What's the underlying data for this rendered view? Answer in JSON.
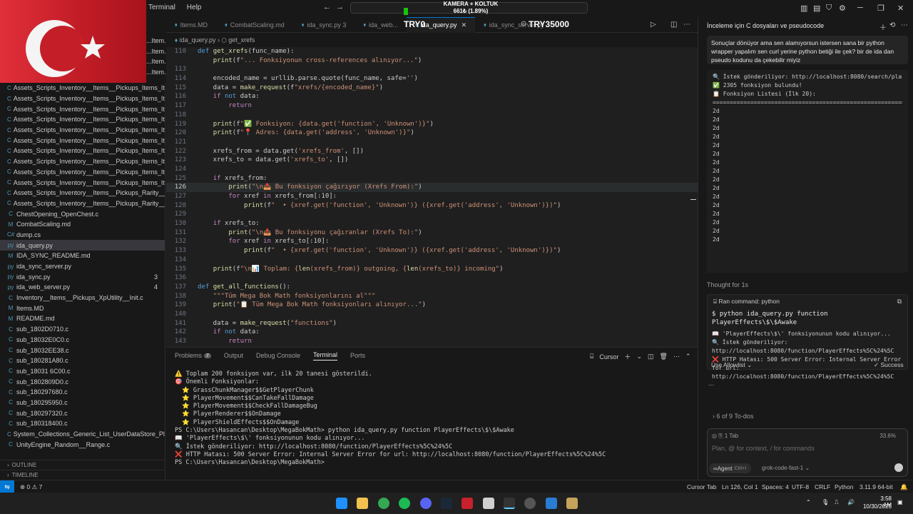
{
  "titlebar": {
    "menu": [
      "Terminal",
      "Help"
    ],
    "overlay_line1": "KAMERA + KOLTUK",
    "overlay_line2": "661₺ (1.89%)"
  },
  "tabs": [
    {
      "label": "Items.MD"
    },
    {
      "label": "CombatScaling.md"
    },
    {
      "label": "ida_sync.py 3"
    },
    {
      "label": "ida_web..."
    },
    {
      "label": "ida_query.py",
      "active": true
    },
    {
      "label": "ida_sync_server.py"
    }
  ],
  "tab_overlays": [
    "TRY0",
    "TRY35000"
  ],
  "breadcrumb": {
    "file": "ida_query.py",
    "symbol": "get_xrefs"
  },
  "explorer": {
    "top_strip": [
      "...Item...",
      "...Item...",
      "...Item...",
      "...Item..."
    ],
    "items": [
      {
        "label": "Assets_Scripts_Inventory__Items__Pickups_Items_Item...",
        "icon": "C"
      },
      {
        "label": "Assets_Scripts_Inventory__Items__Pickups_Items_Item...",
        "icon": "C"
      },
      {
        "label": "Assets_Scripts_Inventory__Items__Pickups_Items_Item...",
        "icon": "C"
      },
      {
        "label": "Assets_Scripts_Inventory__Items__Pickups_Items_Item...",
        "icon": "C"
      },
      {
        "label": "Assets_Scripts_Inventory__Items__Pickups_Items_Item...",
        "icon": "C"
      },
      {
        "label": "Assets_Scripts_Inventory__Items__Pickups_Items_Item...",
        "icon": "C"
      },
      {
        "label": "Assets_Scripts_Inventory__Items__Pickups_Items_Item...",
        "icon": "C"
      },
      {
        "label": "Assets_Scripts_Inventory__Items__Pickups_Items_Item...",
        "icon": "C"
      },
      {
        "label": "Assets_Scripts_Inventory__Items__Pickups_Items_Item...",
        "icon": "C"
      },
      {
        "label": "Assets_Scripts_Inventory__Items__Pickups_Items_Item...",
        "icon": "C"
      },
      {
        "label": "Assets_Scripts_Inventory__Items__Pickups_Rarity__Cal...",
        "icon": "C"
      },
      {
        "label": "Assets_Scripts_Inventory__Items__Pickups_Rarity__Ge...",
        "icon": "C"
      },
      {
        "label": "ChestOpening_OpenChest.c",
        "icon": "C"
      },
      {
        "label": "CombatScaling.md",
        "icon": "M"
      },
      {
        "label": "dump.cs",
        "icon": "C#"
      },
      {
        "label": "ida_query.py",
        "icon": "py",
        "active": true
      },
      {
        "label": "IDA_SYNC_README.md",
        "icon": "M"
      },
      {
        "label": "ida_sync_server.py",
        "icon": "py"
      },
      {
        "label": "ida_sync.py",
        "icon": "py",
        "badge": "3"
      },
      {
        "label": "ida_web_server.py",
        "icon": "py",
        "badge": "4"
      },
      {
        "label": "Inventory__Items__Pickups_XpUtility__Init.c",
        "icon": "C"
      },
      {
        "label": "Items.MD",
        "icon": "M"
      },
      {
        "label": "README.md",
        "icon": "M"
      },
      {
        "label": "sub_1802D0710.c",
        "icon": "C"
      },
      {
        "label": "sub_18032E0C0.c",
        "icon": "C"
      },
      {
        "label": "sub_18032EE38.c",
        "icon": "C"
      },
      {
        "label": "sub_180281A80.c",
        "icon": "C"
      },
      {
        "label": "sub_18031 6C00.c",
        "icon": "C"
      },
      {
        "label": "sub_1802809D0.c",
        "icon": "C"
      },
      {
        "label": "sub_180297680.c",
        "icon": "C"
      },
      {
        "label": "sub_180295950.c",
        "icon": "C"
      },
      {
        "label": "sub_180297320.c",
        "icon": "C"
      },
      {
        "label": "sub_180318400.c",
        "icon": "C"
      },
      {
        "label": "System_Collections_Generic_List_UserDataStore_Play...",
        "icon": "C"
      },
      {
        "label": "UnityEngine_Random__Range.c",
        "icon": "C"
      }
    ],
    "outline": "OUTLINE",
    "timeline": "TIMELINE"
  },
  "code": {
    "lines": [
      {
        "n": "110",
        "t": "def get_xrefs(func_name):"
      },
      {
        "n": "",
        "t": "    print(f\"... Fonksiyonun cross-references alınıyor...\")"
      },
      {
        "n": "113",
        "t": ""
      },
      {
        "n": "114",
        "t": "    encoded_name = urllib.parse.quote(func_name, safe='')"
      },
      {
        "n": "115",
        "t": "    data = make_request(f\"xrefs/{encoded_name}\")"
      },
      {
        "n": "116",
        "t": "    if not data:"
      },
      {
        "n": "117",
        "t": "        return"
      },
      {
        "n": "118",
        "t": ""
      },
      {
        "n": "119",
        "t": "    print(f\"✅ Fonksiyon: {data.get('function', 'Unknown')}\")"
      },
      {
        "n": "120",
        "t": "    print(f\"📍 Adres: {data.get('address', 'Unknown')}\")"
      },
      {
        "n": "121",
        "t": ""
      },
      {
        "n": "122",
        "t": "    xrefs_from = data.get('xrefs_from', [])"
      },
      {
        "n": "123",
        "t": "    xrefs_to = data.get('xrefs_to', [])"
      },
      {
        "n": "124",
        "t": ""
      },
      {
        "n": "125",
        "t": "    if xrefs_from:"
      },
      {
        "n": "126",
        "t": "        print(\"\\n📤 Bu fonksiyon çağırıyor (Xrefs From):\")",
        "current": true
      },
      {
        "n": "127",
        "t": "        for xref in xrefs_from[:10]:"
      },
      {
        "n": "128",
        "t": "            print(f\"  • {xref.get('function', 'Unknown')} ({xref.get('address', 'Unknown')})\")"
      },
      {
        "n": "129",
        "t": ""
      },
      {
        "n": "130",
        "t": "    if xrefs_to:"
      },
      {
        "n": "131",
        "t": "        print(\"\\n📥 Bu fonksiyonu çağıranlar (Xrefs To):\")"
      },
      {
        "n": "132",
        "t": "        for xref in xrefs_to[:10]:"
      },
      {
        "n": "133",
        "t": "            print(f\"  • {xref.get('function', 'Unknown')} ({xref.get('address', 'Unknown')})\")"
      },
      {
        "n": "134",
        "t": ""
      },
      {
        "n": "135",
        "t": "    print(f\"\\n📊 Toplam: {len(xrefs_from)} outgoing, {len(xrefs_to)} incoming\")"
      },
      {
        "n": "136",
        "t": ""
      },
      {
        "n": "137",
        "t": "def get_all_functions():"
      },
      {
        "n": "138",
        "t": "    \"\"\"Tüm Mega Bok Math fonksiyonlarını al\"\"\""
      },
      {
        "n": "139",
        "t": "    print(\"📋 Tüm Mega Bok Math fonksiyonları alınıyor...\")"
      },
      {
        "n": "140",
        "t": ""
      },
      {
        "n": "141",
        "t": "    data = make_request(\"functions\")"
      },
      {
        "n": "142",
        "t": "    if not data:"
      },
      {
        "n": "143",
        "t": "        return"
      }
    ]
  },
  "panel": {
    "tabs": [
      "Problems",
      "Output",
      "Debug Console",
      "Terminal",
      "Ports"
    ],
    "problems_count": "7",
    "shell_label": "Cursor",
    "terminal_lines": [
      "⚠️ Toplam 200 fonksiyon var, ilk 20 tanesi gösterildi.",
      "",
      "🎯 Önemli Fonksiyonlar:",
      "  ⭐ GrassChunkManager$$GetPlayerChunk",
      "  ⭐ PlayerMovement$$CanTakeFallDamage",
      "  ⭐ PlayerMovement$$CheckFallDamageBug",
      "  ⭐ PlayerRenderer$$OnDamage",
      "  ⭐ PlayerShieldEffects$$OnDamage",
      "PS C:\\Users\\Hasancan\\Desktop\\MegaBokMath> python ida_query.py function PlayerEffects\\$\\$Awake",
      "📖 'PlayerEffects\\$\\' fonksiyonunun kodu alınıyor...",
      "🔍 İstek gönderiliyor: http://localhost:8080/function/PlayerEffects%5C%24%5C",
      "❌ HTTP Hatası: 500 Server Error: Internal Server Error for url: http://localhost:8080/function/PlayerEffects%5C%24%5C",
      "PS C:\\Users\\Hasancan\\Desktop\\MegaBokMath> "
    ]
  },
  "agent": {
    "title": "İnceleme için C dosyaları ve pseudocode",
    "user_message": "Sonuçlar dönüyor ama sen alamıyorsun istersen sana bir python wrapper yapalım sen curl yerine python betiği ile çek? bir de ida dan pseudo kodunu da çekebilir miyiz",
    "output1": [
      "🔍 İstek gönderiliyor: http://localhost:8080/search/player",
      "✅ 2305 fonksiyon bulundu!",
      "",
      "📋 Fonksiyon Listesi (İlk 20):",
      "==============================================================",
      "2d",
      "2d",
      "2d",
      "2d",
      "2d",
      "2d",
      "2d",
      "2d",
      "2d",
      "2d",
      "2d",
      "2d",
      "2d",
      "2d",
      "2d",
      "2d"
    ],
    "thought": "Thought for 1s",
    "run_label": "Ran command: python",
    "run_cmd": "$ python ida_query.py function PlayerEffects\\$\\$Awake",
    "run_output": [
      "📖 'PlayerEffects\\$\\' fonksiyonunun kodu alınıyor...",
      "🔍 İstek gönderiliyor: http://localhost:8080/function/PlayerEffects%5C%24%5C",
      "❌ HTTP Hatası: 500 Server Error: Internal Server Error for url: http://localhost:8080/function/PlayerEffects%5C%24%5C"
    ],
    "allowlist": "Use Allowlist",
    "success": "Success",
    "dots": "...",
    "todos": "6 of 9 To-dos",
    "tab_count": "1 Tab",
    "context_pct": "33.6%",
    "input_placeholder": "Plan, @ for context, / for commands",
    "mode": "Agent",
    "mode_shortcut": "Ctrl+I",
    "model": "grok-code-fast-1"
  },
  "statusbar": {
    "errors": "0",
    "warnings": "7",
    "cursor_tab": "Cursor Tab",
    "position": "Ln 126, Col 1",
    "spaces": "Spaces: 4",
    "encoding": "UTF-8",
    "eol": "CRLF",
    "language": "Python",
    "interpreter": "3.11.9 64-bit"
  },
  "taskbar": {
    "time": "3:58 AM",
    "date": "10/30/2025"
  },
  "colors": {
    "accent": "#0078d4",
    "flag_red": "#c8202c",
    "editor_bg": "#1f1f1f"
  }
}
